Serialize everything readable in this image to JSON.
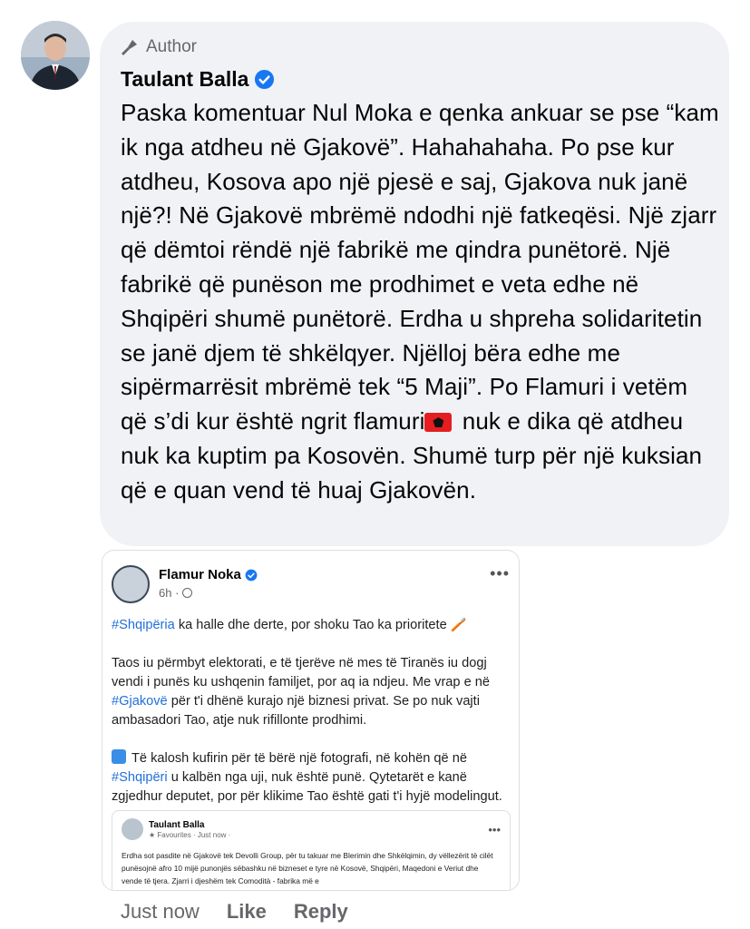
{
  "comment": {
    "author_badge": "Author",
    "name": "Taulant Balla",
    "text_part1": "Paska komentuar Nul Moka e qenka ankuar se pse “kam ik nga atdheu në Gjakovë”. Hahahahaha. Po pse kur atdheu, Kosova apo një pjesë e saj, Gjakova nuk janë një?! Në Gjakovë mbrëmë ndodhi një fatkeqësi. Një zjarr që dëmtoi rëndë një fabrikë me qindra punëtorë. Një fabrikë që punëson me prodhimet e veta edhe në Shqipëri shumë punëtorë. Erdha u shpreha solidaritetin se janë djem të shkëlqyer. Njëlloj bëra edhe me sipërmarrësit mbrëmë tek “5 Maji”. Po Flamuri i vetëm që s’di kur është ngrit flamuri",
    "text_part2": " nuk e dika që atdheu nuk ka kuptim pa Kosovën. Shumë turp për një kuksian që e quan vend të huaj Gjakovën.",
    "actions": {
      "time": "Just now",
      "like": "Like",
      "reply": "Reply"
    }
  },
  "screenshot": {
    "name": "Flamur Noka",
    "time": "6h ·",
    "more": "•••",
    "p1_tag": "#Shqipëria",
    "p1_text": " ka halle dhe derte, por shoku Tao ka prioritete 🪥",
    "p2_a": "Taos iu përmbyt elektorati, e të tjerëve në mes të Tiranës iu dogj vendi i punës ku ushqenin familjet, por aq ia ndjeu. Me vrap e në ",
    "p2_tag": "#Gjakovë",
    "p2_b": " për t'i dhënë kurajo një biznesi privat. Se po nuk vajti ambasadori Tao, atje nuk rifillonte prodhimi.",
    "p3_a": "Të kalosh kufirin për të bërë një fotografi, në kohën që në ",
    "p3_tag": "#Shqipëri",
    "p3_b": " u kalbën nga uji, nuk është punë. Qytetarët e kanë zgjedhur deputet, por për klikime Tao është gati t'i hyjë modelingut.",
    "nested": {
      "name": "Taulant Balla",
      "meta": "★ Favourites · Just now ·",
      "more": "•••",
      "text": "Erdha sot pasdite në Gjakovë tek Devolli Group, për tu takuar me Blerimin dhe Shkëlqimin, dy vëllezërit të cilët punësojnë afro 10 mijë punonjës sëbashku në bizneset e tyre në Kosovë, Shqipëri, Maqedoni e Veriut dhe vende të tjera. Zjarri i djeshëm tek Comodità - fabrika më e"
    }
  }
}
